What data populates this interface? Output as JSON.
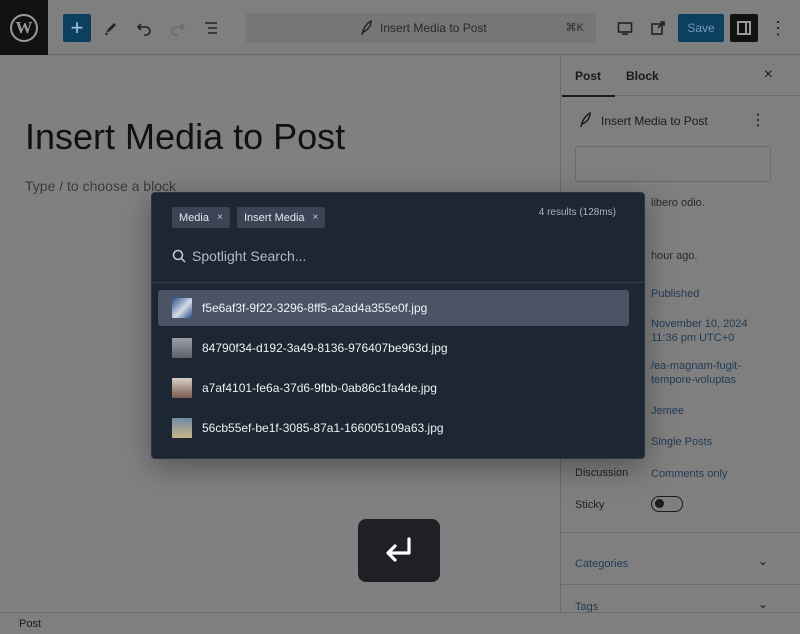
{
  "toolbar": {
    "wp_logo": "W",
    "add_label": "+",
    "document_title": "Insert Media to Post",
    "shortcut": "⌘K",
    "save_label": "Save",
    "more": "⋮"
  },
  "editor": {
    "post_title": "Insert Media to Post",
    "block_hint": "Type / to choose a block"
  },
  "sidebar": {
    "tabs": [
      {
        "label": "Post",
        "active": true
      },
      {
        "label": "Block",
        "active": false
      }
    ],
    "close": "×",
    "post_name": "Insert Media to Post",
    "more": "⋮",
    "excerpt_text": "libero odio.",
    "time_text": "hour ago.",
    "fields": [
      {
        "label": "",
        "value": "Published"
      },
      {
        "label": "",
        "value": "November 10, 2024 11:36 pm UTC+0"
      },
      {
        "label": "",
        "value": "/ea-magnam-fugit-tempore-voluptas"
      },
      {
        "label": "",
        "value": "Jemee"
      },
      {
        "label": "",
        "value": "Single Posts"
      },
      {
        "label": "Discussion",
        "value": "Comments only"
      }
    ],
    "sticky_label": "Sticky",
    "sections": [
      {
        "label": "Categories",
        "chevron": "⌄"
      },
      {
        "label": "Tags",
        "chevron": "⌄"
      }
    ]
  },
  "statusbar": {
    "breadcrumb": "Post"
  },
  "spotlight": {
    "chips": [
      {
        "label": "Media",
        "remove": "×"
      },
      {
        "label": "Insert Media",
        "remove": "×"
      }
    ],
    "results_count": "4 results (128ms)",
    "search_placeholder": "Spotlight Search...",
    "results": [
      {
        "name": "f5e6af3f-9f22-3296-8ff5-a2ad4a355e0f.jpg",
        "selected": true,
        "thumb_colors": [
          "#2b4f8a",
          "#d4dbe8"
        ]
      },
      {
        "name": "84790f34-d192-3a49-8136-976407be963d.jpg",
        "selected": false,
        "thumb_colors": [
          "#5e6268",
          "#9aa0a7"
        ]
      },
      {
        "name": "a7af4101-fe6a-37d6-9fbb-0ab86c1fa4de.jpg",
        "selected": false,
        "thumb_colors": [
          "#d8cfc6",
          "#7a5a4d"
        ]
      },
      {
        "name": "56cb55ef-be1f-3085-87a1-166005109a63.jpg",
        "selected": false,
        "thumb_colors": [
          "#c9b68a",
          "#6f8aa3"
        ]
      }
    ]
  },
  "colors": {
    "accent": "#0d3f5e",
    "modal_bg": "#1d2633",
    "selected_row": "#4b5467"
  },
  "icons": [
    "wordpress-icon",
    "plus-icon",
    "pen-icon",
    "undo-icon",
    "redo-icon",
    "list-view-icon",
    "feather-icon",
    "desktop-preview-icon",
    "external-link-icon",
    "sidebar-icon",
    "kebab-icon",
    "close-icon",
    "search-icon",
    "enter-key-icon",
    "chevron-down-icon"
  ]
}
